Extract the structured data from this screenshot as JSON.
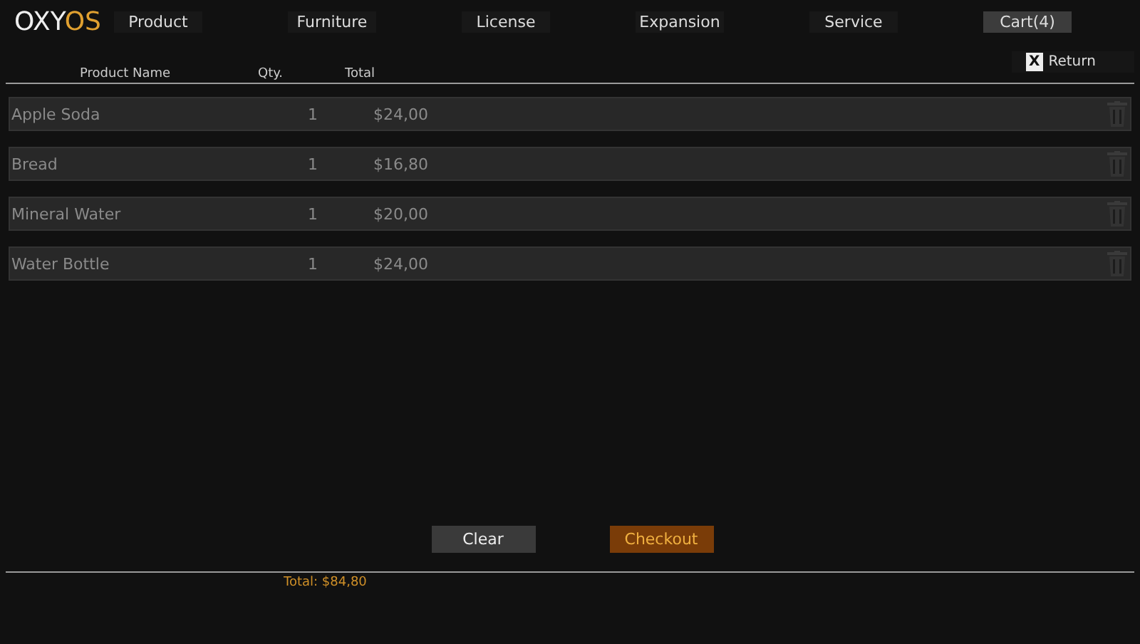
{
  "logo": {
    "text": "OXY",
    "accent": "OS"
  },
  "tabs": [
    {
      "label": "Product",
      "selected": false
    },
    {
      "label": "Furniture",
      "selected": false
    },
    {
      "label": "License",
      "selected": false
    },
    {
      "label": "Expansion",
      "selected": false
    },
    {
      "label": "Service",
      "selected": false
    },
    {
      "label": "Cart(4)",
      "selected": true
    }
  ],
  "return_button": {
    "key": "X",
    "label": "Return"
  },
  "table": {
    "columns": [
      "Product Name",
      "Qty.",
      "Total"
    ],
    "rows": [
      {
        "name": "Apple Soda",
        "qty": "1",
        "total": "$24,00"
      },
      {
        "name": "Bread",
        "qty": "1",
        "total": "$16,80"
      },
      {
        "name": "Mineral Water",
        "qty": "1",
        "total": "$20,00"
      },
      {
        "name": "Water Bottle",
        "qty": "1",
        "total": "$24,00"
      }
    ]
  },
  "buttons": {
    "clear": "Clear",
    "checkout": "Checkout"
  },
  "total": "Total: $84,80"
}
